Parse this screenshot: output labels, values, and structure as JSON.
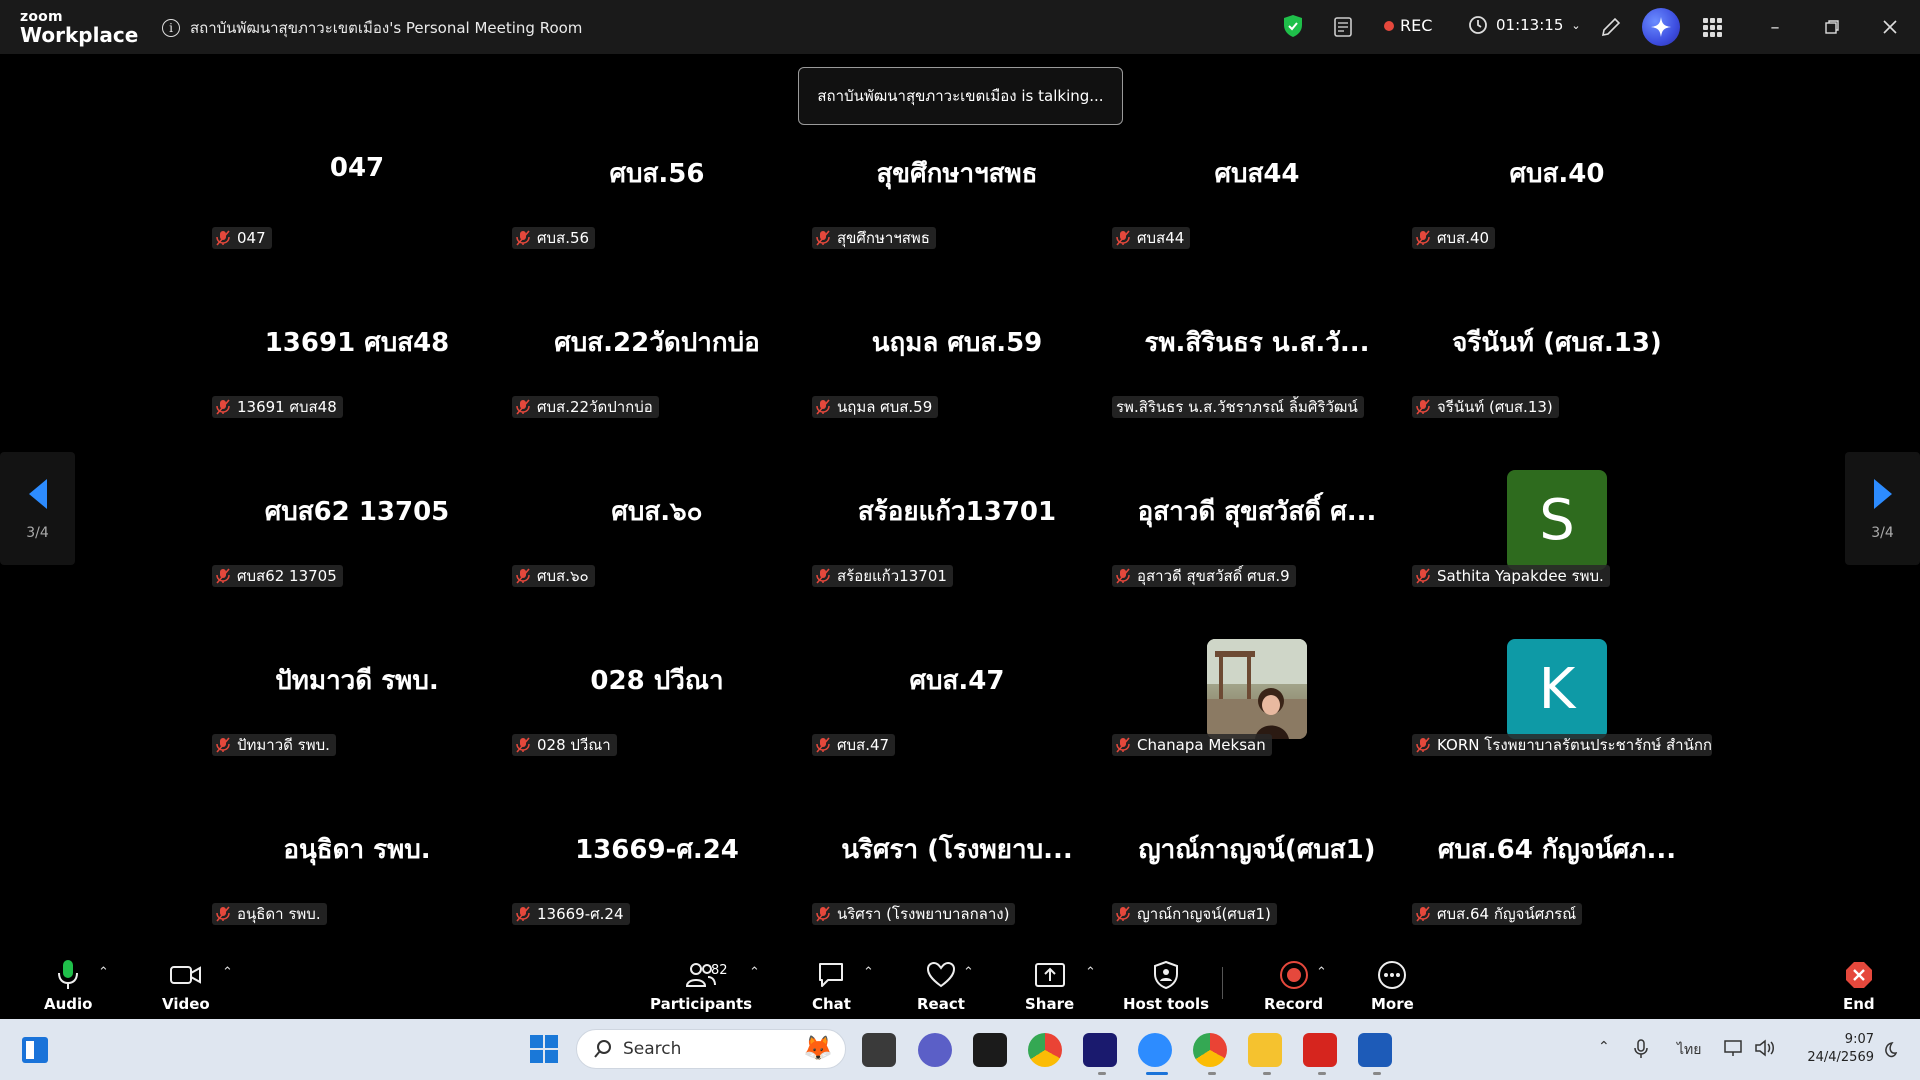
{
  "app": {
    "logo_top": "zoom",
    "logo_bottom": "Workplace"
  },
  "titlebar": {
    "meeting_title": "สถาบันพัฒนาสุขภาวะเขตเมือง's Personal Meeting Room",
    "rec_label": "REC",
    "timer": "01:13:15"
  },
  "talking_indicator": "สถาบันพัฒนาสุขภาวะเขตเมือง is talking...",
  "pager": {
    "left": "3/4",
    "right": "3/4"
  },
  "tiles": [
    {
      "big": "047",
      "label": "047",
      "muted": true
    },
    {
      "big": "ศบส.56",
      "label": "ศบส.56",
      "muted": true
    },
    {
      "big": "สุขศึกษาฯสพธ",
      "label": "สุขศึกษาฯสพธ",
      "muted": true
    },
    {
      "big": "ศบส44",
      "label": "ศบส44",
      "muted": true
    },
    {
      "big": "ศบส.40",
      "label": "ศบส.40",
      "muted": true
    },
    {
      "big": "13691 ศบส48",
      "label": "13691 ศบส48",
      "muted": true
    },
    {
      "big": "ศบส.22วัดปากบ่อ",
      "label": "ศบส.22วัดปากบ่อ",
      "muted": true
    },
    {
      "big": "นฤมล ศบส.59",
      "label": "นฤมล ศบส.59",
      "muted": true
    },
    {
      "big": "รพ.สิรินธร น.ส.วั...",
      "label": "รพ.สิรินธร น.ส.วัชราภรณ์ ลิ้มศิริวัฒน์",
      "muted": false
    },
    {
      "big": "จรีนันท์ (ศบส.13)",
      "label": "จรีนันท์ (ศบส.13)",
      "muted": true
    },
    {
      "big": "ศบส62 13705",
      "label": "ศบส62 13705",
      "muted": true
    },
    {
      "big": "ศบส.๖๐",
      "label": "ศบส.๖๐",
      "muted": true
    },
    {
      "big": "สร้อยแก้ว13701",
      "label": "สร้อยแก้ว13701",
      "muted": true
    },
    {
      "big": "อุสาวดี สุขสวัสดิ์ ศ...",
      "label": "อุสาวดี สุขสวัสดิ์ ศบส.9",
      "muted": true
    },
    {
      "big": "",
      "avatar": "S",
      "avatar_color": "#2e6b1e",
      "label": "Sathita Yapakdee รพบ.",
      "muted": true
    },
    {
      "big": "ปัทมาวดี รพบ.",
      "label": "ปัทมาวดี รพบ.",
      "muted": true
    },
    {
      "big": "028 ปวีณา",
      "label": "028 ปวีณา",
      "muted": true
    },
    {
      "big": "ศบส.47",
      "label": "ศบส.47",
      "muted": true
    },
    {
      "big": "",
      "photo": true,
      "label": "Chanapa Meksan",
      "muted": true
    },
    {
      "big": "",
      "avatar": "K",
      "avatar_color": "#0e9aa6",
      "label": "KORN โรงพยาบาลรัตนประชารักษ์ สำนักก...",
      "muted": true
    },
    {
      "big": "อนุธิดา รพบ.",
      "label": "อนุธิดา รพบ.",
      "muted": true
    },
    {
      "big": "13669-ศ.24",
      "label": "13669-ศ.24",
      "muted": true
    },
    {
      "big": "นริศรา (โรงพยาบ...",
      "label": "นริศรา (โรงพยาบาลกลาง)",
      "muted": true
    },
    {
      "big": "ญาณ์กาญจน์(ศบส1)",
      "label": "ญาณ์กาญจน์(ศบส1)",
      "muted": true
    },
    {
      "big": "ศบส.64 กัญจน์ศภ...",
      "label": "ศบส.64 กัญจน์ศภรณ์",
      "muted": true
    }
  ],
  "toolbar": {
    "audio": "Audio",
    "video": "Video",
    "participants": "Participants",
    "participants_count": "82",
    "chat": "Chat",
    "react": "React",
    "share": "Share",
    "host_tools": "Host tools",
    "record": "Record",
    "more": "More",
    "end": "End"
  },
  "taskbar": {
    "search_placeholder": "Search",
    "lang": "ไทย",
    "time": "9:07",
    "date": "24/4/2569"
  },
  "colors": {
    "accent_blue": "#2d8cff",
    "rec_red": "#e5483c",
    "shield_green": "#1fbf4a",
    "ai_purple": "#3d4ee0"
  }
}
